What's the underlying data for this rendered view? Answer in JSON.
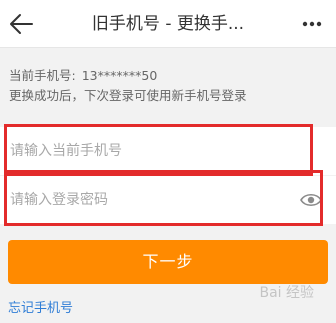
{
  "header": {
    "title": "旧手机号 - 更换手...",
    "back_icon": "arrow-left-icon",
    "more_icon": "more-dots-icon"
  },
  "info": {
    "current_phone_label": "当前手机号:",
    "current_phone_value": "13*******50",
    "hint": "更换成功后，下次登录可使用新手机号登录"
  },
  "form": {
    "phone_placeholder": "请输入当前手机号",
    "password_placeholder": "请输入登录密码",
    "password_toggle_icon": "eye-icon"
  },
  "actions": {
    "next_label": "下一步",
    "forgot_label": "忘记手机号"
  },
  "watermark": {
    "text": "Bai 经验"
  },
  "colors": {
    "accent": "#ff8a00",
    "highlight": "#e32b2b",
    "link": "#2f7dd6"
  }
}
